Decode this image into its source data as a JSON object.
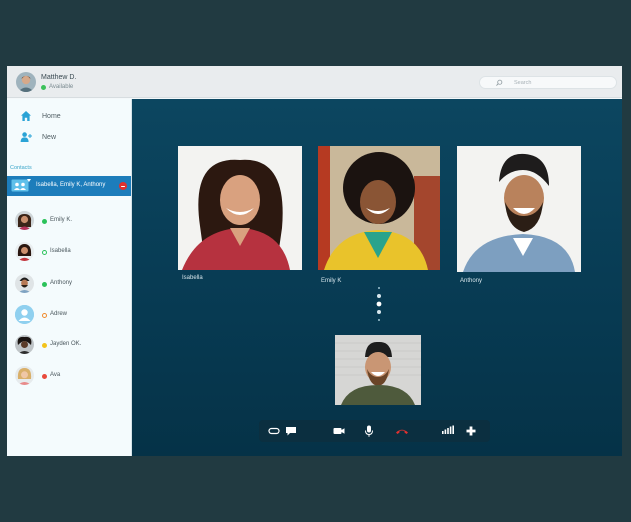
{
  "user": {
    "name": "Matthew D.",
    "status": "Available",
    "status_color": "#3cc15a"
  },
  "search": {
    "placeholder": "Search"
  },
  "nav": [
    {
      "label": "Home",
      "icon": "home-icon"
    },
    {
      "label": "New",
      "icon": "add-user-icon"
    }
  ],
  "contacts_label": "Contacts",
  "active_group": {
    "label": "Isabella, Emily K, Anthony",
    "icon": "group-chat-icon",
    "end_icon": "end-call-icon"
  },
  "contacts": [
    {
      "name": "Emily K.",
      "status": "online",
      "color": "#2bc25a"
    },
    {
      "name": "Isabella",
      "status": "available",
      "color": "#2bc25a"
    },
    {
      "name": "Anthony",
      "status": "online",
      "color": "#2bc25a"
    },
    {
      "name": "Adrew",
      "status": "away",
      "color": "#f08a2c"
    },
    {
      "name": "Jayden OK.",
      "status": "idle",
      "color": "#f3c31b"
    },
    {
      "name": "Ava",
      "status": "busy",
      "color": "#e84a3c"
    }
  ],
  "participants": [
    {
      "name": "Isabella"
    },
    {
      "name": "Emily K"
    },
    {
      "name": "Anthony"
    }
  ],
  "self_view": {
    "name": ""
  },
  "controls": [
    "toggle-icon",
    "chat-icon",
    "camera-icon",
    "microphone-icon",
    "hang-up-icon",
    "signal-icon",
    "add-icon"
  ],
  "colors": {
    "accent": "#1d7dbb",
    "stage": "#0a4360",
    "hangup": "#e0312f"
  }
}
